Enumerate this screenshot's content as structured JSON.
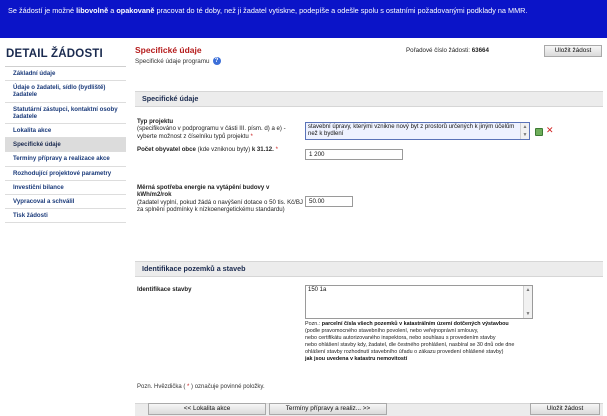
{
  "banner": {
    "t1": "Se žádostí je možné ",
    "b1": "libovolně",
    "t2": " a ",
    "b2": "opakovaně",
    "t3": " pracovat do té doby, než ji žadatel vytiskne, podepíše a odešle spolu s ostatními požadovanými podklady na MMR."
  },
  "sidebar": {
    "title": "DETAIL ŽÁDOSTI",
    "items": [
      {
        "label": "Základní údaje"
      },
      {
        "label": "Údaje o žadateli, sídlo (bydliště) žadatele"
      },
      {
        "label": "Statutární zástupci, kontaktní osoby žadatele"
      },
      {
        "label": "Lokalita akce"
      },
      {
        "label": "Specifické údaje"
      },
      {
        "label": "Termíny přípravy a realizace akce"
      },
      {
        "label": "Rozhodující projektové parametry"
      },
      {
        "label": "Investiční bilance"
      },
      {
        "label": "Vypracoval a schválil"
      },
      {
        "label": "Tisk žádosti"
      }
    ],
    "active_index": 4
  },
  "header": {
    "title": "Specifické údaje",
    "subtitle": "Specifické údaje programu",
    "help_icon": "help-icon",
    "order_label": "Pořadové číslo žádosti:",
    "order_value": "63664",
    "save_label": "Uložit žádost"
  },
  "section1": {
    "title": "Specifické údaje",
    "typ_projektu": {
      "label": "Typ projektu",
      "hint": "(specifikováno v podprogramu v části III. písm. d) a e) - vyberte možnost z číselníku typů projektu",
      "required_mark": "*",
      "value": "stavební úpravy, kterými vznikne nový byt z prostorů určených k jiným účelům než k bydlení",
      "add_icon": "add-icon",
      "delete_icon": "delete-icon",
      "delete_glyph": "✕"
    },
    "pocet_obyvatel": {
      "label_bold": "Počet obyvatel obce",
      "label_rest": " (kde vzniknou byty) ",
      "label_bold2": "k 31.12.",
      "required_mark": "*",
      "value": "1 200"
    },
    "energie": {
      "label": "Měrná spotřeba energie na vytápění budovy v kWh/m2/rok",
      "hint": "(žadatel vyplní, pokud žádá o navýšení dotace o 50 tis. Kč/BJ za splnění podmínky k nízkoenergetickému standardu)",
      "value": "50.00"
    }
  },
  "section2": {
    "title": "Identifikace pozemků a staveb",
    "stavby": {
      "label": "Identifikace stavby",
      "value": "150 1a"
    },
    "note": {
      "prefix": "Pozn.: ",
      "bold1": "parcelní čísla všech pozemků v katastrálním území dotčených výstavbou",
      "line2": "(podle pravomocného stavebního povolení, nebo veřejnoprávní smlouvy,",
      "line3": "nebo certifikátu autorizovaného inspektora, nebo souhlasu s provedením stavby",
      "line4": "nebo ohlášení stavby kdy, žadatel, dle čestného prohlášení, nasbíral se 30 dnů ode dne",
      "line5": "ohlášení stavby rozhodnutí stavebního úřadu o zákazu provedení ohlášené stavby)",
      "bold2": "jak jsou uvedena v katastru nemovitostí"
    }
  },
  "footer": {
    "note_prefix": "Pozn. Hvězdička ( ",
    "note_star": "*",
    "note_suffix": " ) označuje povinné položky.",
    "prev_label": "<< Lokalita akce",
    "next_label": "Termíny přípravy a realiz... >>",
    "save_label": "Uložit žádost"
  },
  "colors": {
    "banner_bg": "#0b14c8",
    "title_red": "#b51b1b",
    "required_red": "#c91b1b",
    "nav_blue": "#1a3a7a"
  }
}
